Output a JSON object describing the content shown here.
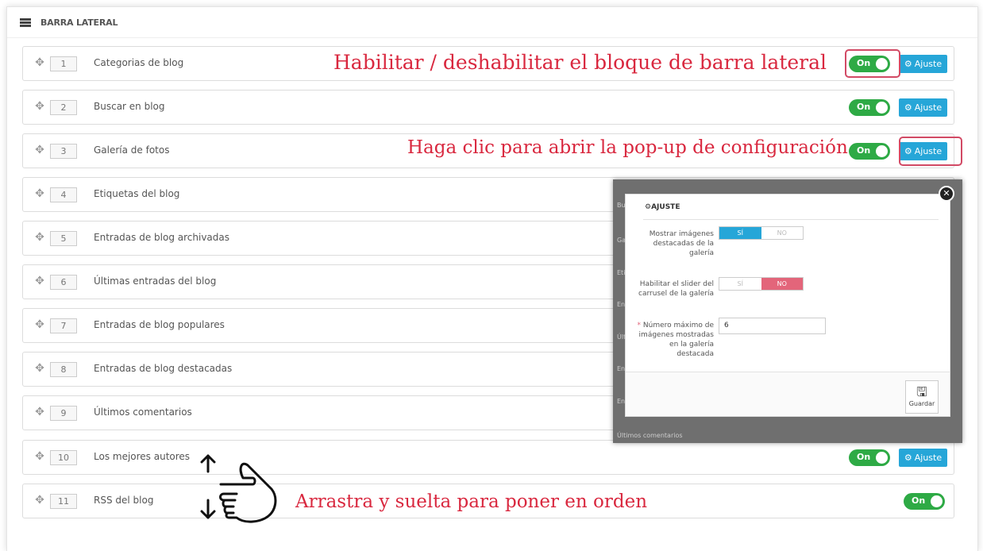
{
  "panel": {
    "title": "BARRA LATERAL"
  },
  "rows": [
    {
      "pos": "1",
      "label": "Categorias de blog",
      "toggle": "On",
      "button": "Ajuste"
    },
    {
      "pos": "2",
      "label": "Buscar en blog",
      "toggle": "On",
      "button": "Ajuste"
    },
    {
      "pos": "3",
      "label": "Galería de fotos",
      "toggle": "On",
      "button": "Ajuste"
    },
    {
      "pos": "4",
      "label": "Etiquetas del blog"
    },
    {
      "pos": "5",
      "label": "Entradas de blog archivadas"
    },
    {
      "pos": "6",
      "label": "Últimas entradas del blog"
    },
    {
      "pos": "7",
      "label": "Entradas de blog populares"
    },
    {
      "pos": "8",
      "label": "Entradas de blog destacadas"
    },
    {
      "pos": "9",
      "label": "Últimos comentarios"
    },
    {
      "pos": "10",
      "label": "Los mejores autores",
      "toggle": "On",
      "button": "Ajuste"
    },
    {
      "pos": "11",
      "label": "RSS del blog",
      "toggle": "On"
    }
  ],
  "annotations": {
    "enable": "Habilitar / deshabilitar el bloque de barra lateral",
    "popup": "Haga clic para abrir la pop-up de configuración",
    "drag": "Arrastra y suelta para poner en orden"
  },
  "modal": {
    "title": "AJUSTE",
    "field1_label": "Mostrar imágenes destacadas de la galería",
    "field1_yes": "SÍ",
    "field1_no": "NO",
    "field2_label": "Habilitar el slider del carrusel de la galería",
    "field2_yes": "SÍ",
    "field2_no": "NO",
    "field3_required": "*",
    "field3_label": "Número máximo de imágenes mostradas en la galería destacada",
    "field3_value": "6",
    "save": "Guardar",
    "bg_fragments": [
      "Bus",
      "Gal",
      "Etiq",
      "Ent",
      "Últi",
      "Ent",
      "Ent",
      "Últimos comentarios"
    ]
  },
  "colors": {
    "toggle_on": "#2eaa45",
    "button_blue": "#26a6d8",
    "annotation_red": "#d9283f",
    "no_active": "#e3657a"
  }
}
